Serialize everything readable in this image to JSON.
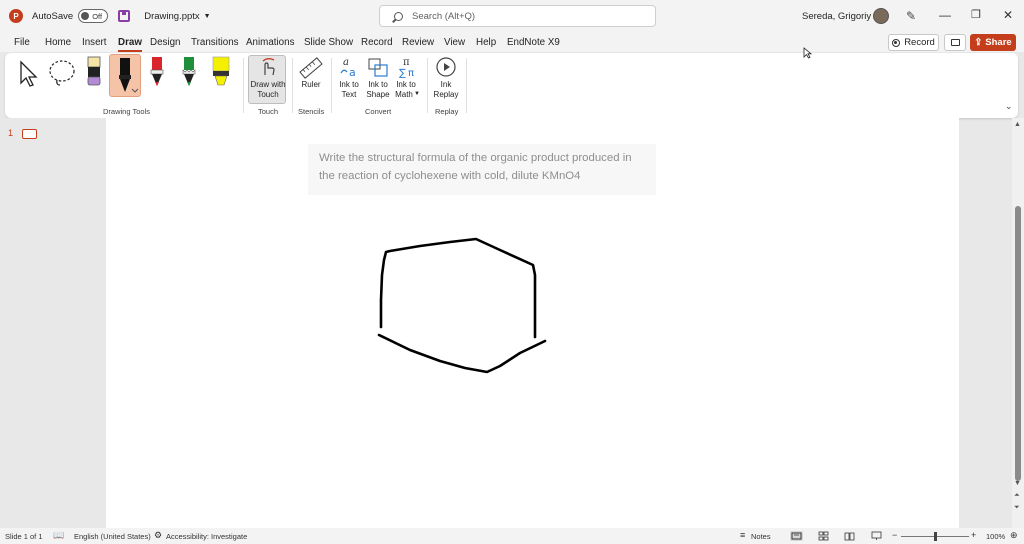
{
  "titlebar": {
    "autosave_label": "AutoSave",
    "autosave_state": "Off",
    "filename": "Drawing.pptx",
    "search_placeholder": "Search (Alt+Q)",
    "username": "Sereda, Grigoriy A"
  },
  "tabs": [
    {
      "label": "File"
    },
    {
      "label": "Home"
    },
    {
      "label": "Insert"
    },
    {
      "label": "Draw",
      "active": true
    },
    {
      "label": "Design"
    },
    {
      "label": "Transitions"
    },
    {
      "label": "Animations"
    },
    {
      "label": "Slide Show"
    },
    {
      "label": "Record"
    },
    {
      "label": "Review"
    },
    {
      "label": "View"
    },
    {
      "label": "Help"
    },
    {
      "label": "EndNote X9"
    }
  ],
  "actions": {
    "record_label": "Record",
    "share_label": "Share"
  },
  "ribbon": {
    "groups": {
      "drawing_tools": "Drawing Tools",
      "touch": "Touch",
      "stencils": "Stencils",
      "convert": "Convert",
      "replay": "Replay"
    },
    "draw_with_touch": [
      "Draw with",
      "Touch"
    ],
    "ruler": "Ruler",
    "ink_to_text": [
      "Ink to",
      "Text"
    ],
    "ink_to_shape": [
      "Ink to",
      "Shape"
    ],
    "ink_to_math": [
      "Ink to",
      "Math"
    ],
    "ink_replay": [
      "Ink",
      "Replay"
    ],
    "pen_colors": {
      "purple_highlighter": "#b48ad6",
      "black_pen": "#000000",
      "red_pen": "#d9252b",
      "green_pen": "#1f8f3a",
      "yellow_highlighter": "#f5f000"
    }
  },
  "thumbnails": {
    "slide_number": "1"
  },
  "slide": {
    "question": "Write the structural formula of the organic product produced in the reaction of cyclohexene with cold, dilute KMnO4"
  },
  "status": {
    "slide_info": "Slide 1 of 1",
    "language": "English (United States)",
    "accessibility": "Accessibility: Investigate",
    "notes": "Notes",
    "zoom": "100%"
  },
  "colors": {
    "accent": "#c43e1c"
  }
}
